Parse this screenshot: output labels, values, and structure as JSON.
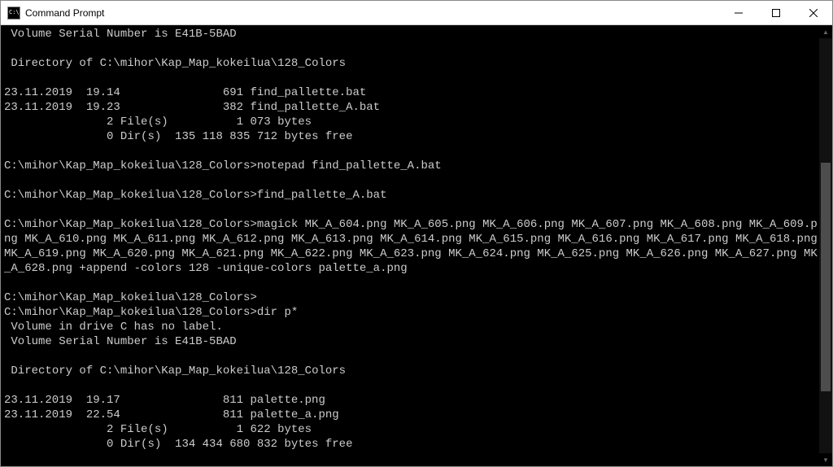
{
  "window": {
    "title": "Command Prompt"
  },
  "terminal": {
    "lines": [
      " Volume Serial Number is E41B-5BAD",
      "",
      " Directory of C:\\mihor\\Kap_Map_kokeilua\\128_Colors",
      "",
      "23.11.2019  19.14               691 find_pallette.bat",
      "23.11.2019  19.23               382 find_pallette_A.bat",
      "               2 File(s)          1 073 bytes",
      "               0 Dir(s)  135 118 835 712 bytes free",
      "",
      "C:\\mihor\\Kap_Map_kokeilua\\128_Colors>notepad find_pallette_A.bat",
      "",
      "C:\\mihor\\Kap_Map_kokeilua\\128_Colors>find_pallette_A.bat",
      "",
      "C:\\mihor\\Kap_Map_kokeilua\\128_Colors>magick MK_A_604.png MK_A_605.png MK_A_606.png MK_A_607.png MK_A_608.png MK_A_609.png MK_A_610.png MK_A_611.png MK_A_612.png MK_A_613.png MK_A_614.png MK_A_615.png MK_A_616.png MK_A_617.png MK_A_618.png MK_A_619.png MK_A_620.png MK_A_621.png MK_A_622.png MK_A_623.png MK_A_624.png MK_A_625.png MK_A_626.png MK_A_627.png MK_A_628.png +append -colors 128 -unique-colors palette_a.png",
      "",
      "C:\\mihor\\Kap_Map_kokeilua\\128_Colors>",
      "C:\\mihor\\Kap_Map_kokeilua\\128_Colors>dir p*",
      " Volume in drive C has no label.",
      " Volume Serial Number is E41B-5BAD",
      "",
      " Directory of C:\\mihor\\Kap_Map_kokeilua\\128_Colors",
      "",
      "23.11.2019  19.17               811 palette.png",
      "23.11.2019  22.54               811 palette_a.png",
      "               2 File(s)          1 622 bytes",
      "               0 Dir(s)  134 434 680 832 bytes free"
    ]
  }
}
